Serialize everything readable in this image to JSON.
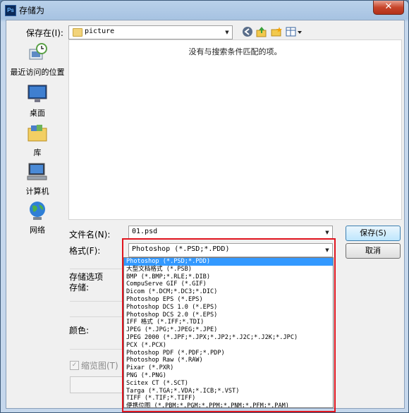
{
  "window": {
    "title": "存储为",
    "app_icon": "Ps",
    "close_glyph": "✕"
  },
  "toolbar": {
    "save_in_label": "保存在(I):",
    "folder_name": "picture",
    "icons": [
      "back-icon",
      "up-folder-icon",
      "new-folder-icon",
      "view-menu-icon"
    ]
  },
  "places": [
    {
      "label": "最近访问的位置",
      "icon": "recent-places-icon"
    },
    {
      "label": "桌面",
      "icon": "desktop-icon"
    },
    {
      "label": "库",
      "icon": "libraries-icon"
    },
    {
      "label": "计算机",
      "icon": "computer-icon"
    },
    {
      "label": "网络",
      "icon": "network-icon"
    }
  ],
  "file_list": {
    "empty_message": "没有与搜索条件匹配的项。"
  },
  "filename": {
    "label": "文件名(N):",
    "value": "01.psd"
  },
  "format": {
    "label": "格式(F):",
    "selected": "Photoshop (*.PSD;*.PDD)",
    "options": [
      "Photoshop (*.PSD;*.PDD)",
      "大型文档格式 (*.PSB)",
      "BMP (*.BMP;*.RLE;*.DIB)",
      "CompuServe GIF (*.GIF)",
      "Dicom (*.DCM;*.DC3;*.DIC)",
      "Photoshop EPS (*.EPS)",
      "Photoshop DCS 1.0 (*.EPS)",
      "Photoshop DCS 2.0 (*.EPS)",
      "IFF 格式 (*.IFF;*.TDI)",
      "JPEG (*.JPG;*.JPEG;*.JPE)",
      "JPEG 2000 (*.JPF;*.JPX;*.JP2;*.J2C;*.J2K;*.JPC)",
      "PCX (*.PCX)",
      "Photoshop PDF (*.PDF;*.PDP)",
      "Photoshop Raw (*.RAW)",
      "Pixar (*.PXR)",
      "PNG (*.PNG)",
      "Scitex CT (*.SCT)",
      "Targa (*.TGA;*.VDA;*.ICB;*.VST)",
      "TIFF (*.TIF;*.TIFF)",
      "便携位图 (*.PBM;*.PGM;*.PPM;*.PNM;*.PFM;*.PAM)"
    ]
  },
  "buttons": {
    "save": "保存(S)",
    "cancel": "取消"
  },
  "options": {
    "section_label": "存储选项",
    "storage_label": "存储:",
    "color_label": "颜色:",
    "thumbnail_label": "缩览图(T)",
    "thumbnail_checked": true
  },
  "colors": {
    "highlight": "#3399ff",
    "annotation_box": "#e0141e"
  }
}
